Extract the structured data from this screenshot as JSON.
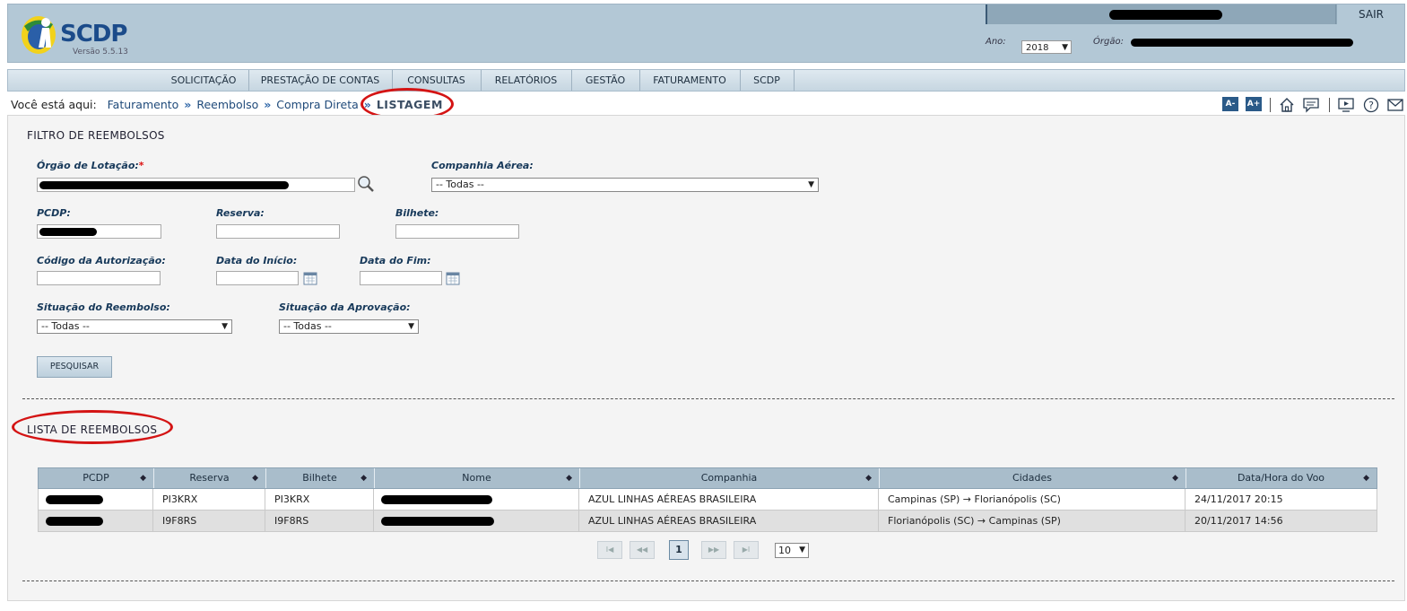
{
  "header": {
    "logo_text": "SCDP",
    "version": "Versão 5.5.13",
    "sair": "SAIR",
    "ano_label": "Ano:",
    "ano_value": "2018",
    "orgao_label": "Órgão:"
  },
  "menu": {
    "items": [
      "SOLICITAÇÃO",
      "PRESTAÇÃO DE CONTAS",
      "CONSULTAS",
      "RELATÓRIOS",
      "GESTÃO",
      "FATURAMENTO",
      "SCDP"
    ]
  },
  "breadcrumb": {
    "prefix": "Você está aqui:",
    "links": [
      "Faturamento",
      "Reembolso",
      "Compra Direta"
    ],
    "current": "LISTAGEM"
  },
  "tools": {
    "font_decrease": "A-",
    "font_increase": "A+",
    "icons": [
      "home-icon",
      "chat-icon",
      "video-icon",
      "help-icon",
      "mail-icon"
    ]
  },
  "filter": {
    "title": "FILTRO DE REEMBOLSOS",
    "orgao_label": "Órgão de Lotação:",
    "required_mark": "*",
    "companhia_label": "Companhia Aérea:",
    "companhia_value": "-- Todas --",
    "pcdp_label": "PCDP:",
    "reserva_label": "Reserva:",
    "bilhete_label": "Bilhete:",
    "codigo_label": "Código da Autorização:",
    "data_inicio_label": "Data do Início:",
    "data_fim_label": "Data do Fim:",
    "sit_reembolso_label": "Situação do Reembolso:",
    "sit_reembolso_value": "-- Todas --",
    "sit_aprovacao_label": "Situação da Aprovação:",
    "sit_aprovacao_value": "-- Todas --",
    "search_button": "PESQUISAR"
  },
  "list": {
    "title": "LISTA DE REEMBOLSOS",
    "columns": [
      "PCDP",
      "Reserva",
      "Bilhete",
      "Nome",
      "Companhia",
      "Cidades",
      "Data/Hora do Voo"
    ],
    "rows": [
      {
        "reserva": "PI3KRX",
        "bilhete": "PI3KRX",
        "companhia": "AZUL LINHAS AÉREAS BRASILEIRA",
        "cidades": "Campinas (SP) → Florianópolis (SC)",
        "data": "24/11/2017 20:15"
      },
      {
        "reserva": "I9F8RS",
        "bilhete": "I9F8RS",
        "companhia": "AZUL LINHAS AÉREAS BRASILEIRA",
        "cidades": "Florianópolis (SC) → Campinas (SP)",
        "data": "20/11/2017 14:56"
      }
    ]
  },
  "pager": {
    "first": "I◀",
    "prev": "◀◀",
    "current": "1",
    "next": "▶▶",
    "last": "▶I",
    "page_size": "10"
  },
  "colors": {
    "header_bg": "#b3c8d6",
    "link": "#1f4a7a",
    "annotation_red": "#d41414",
    "grid_header": "#a9bdcb"
  }
}
